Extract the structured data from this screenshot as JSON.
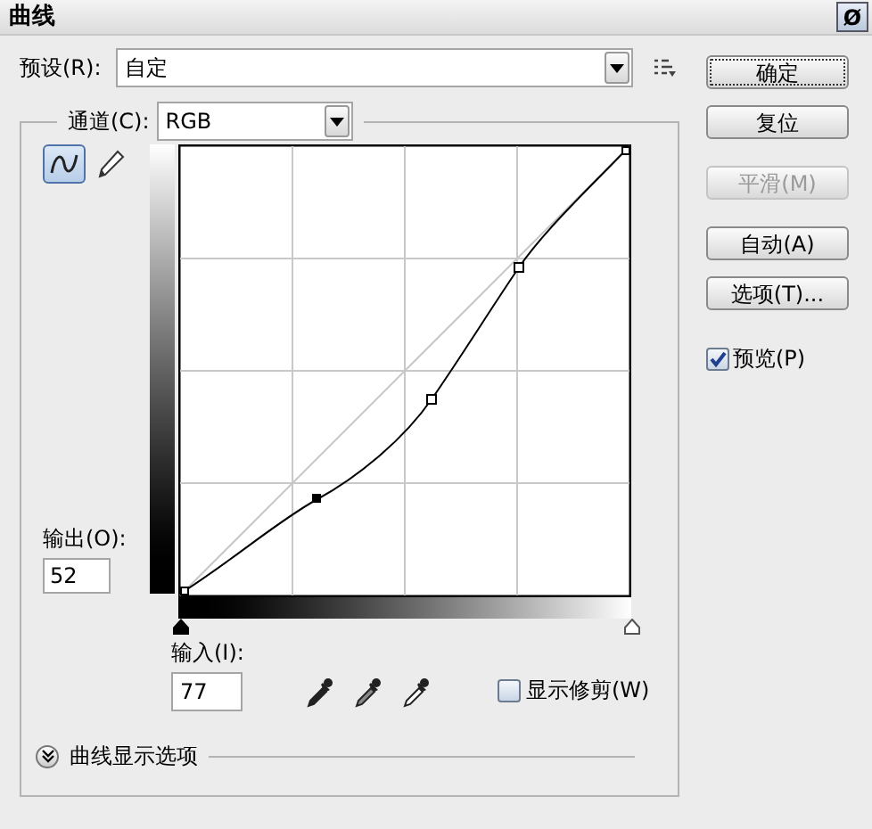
{
  "window": {
    "title": "曲线",
    "close_glyph": "Ø"
  },
  "preset": {
    "label": "预设(R):",
    "value": "自定"
  },
  "channel": {
    "label": "通道(C):",
    "value": "RGB"
  },
  "tools": [
    {
      "kind": "curve",
      "selected": true
    },
    {
      "kind": "pencil",
      "selected": false
    }
  ],
  "output": {
    "label": "输出(O):",
    "value": "52"
  },
  "input": {
    "label": "输入(I):",
    "value": "77"
  },
  "show_clipping": {
    "label": "显示修剪(W)",
    "checked": false
  },
  "display_options": {
    "label": "曲线显示选项",
    "expanded": false
  },
  "buttons": [
    {
      "label": "确定",
      "disabled": false,
      "focused": true
    },
    {
      "label": "复位",
      "disabled": false,
      "focused": false
    },
    {
      "label": "平滑(M)",
      "disabled": true,
      "focused": false
    },
    {
      "label": "自动(A)",
      "disabled": false,
      "focused": false
    },
    {
      "label": "选项(T)...",
      "disabled": false,
      "focused": false
    }
  ],
  "preview": {
    "label": "预览(P)",
    "checked": true
  }
}
